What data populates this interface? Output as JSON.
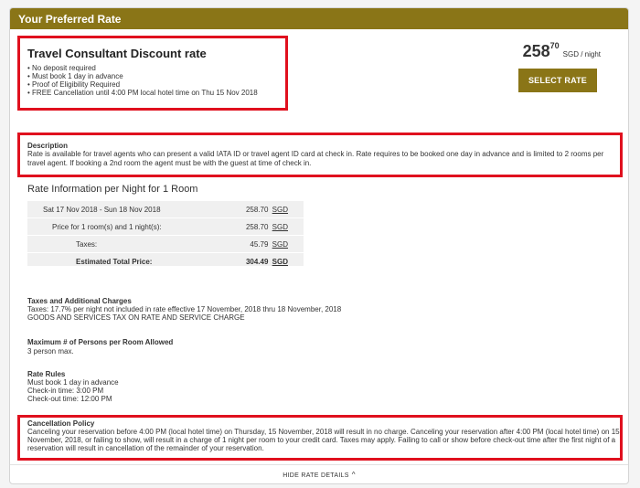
{
  "header": {
    "title": "Your Preferred Rate"
  },
  "rate": {
    "name": "Travel Consultant Discount rate",
    "bullets": [
      "No deposit required",
      "Must book 1 day in advance",
      "Proof of Eligibility Required",
      "FREE Cancellation until 4:00 PM local hotel time on Thu 15 Nov 2018"
    ],
    "price_whole": "258",
    "price_cents": "70",
    "price_unit": "SGD / night",
    "select_label": "SELECT RATE"
  },
  "description": {
    "heading": "Description",
    "text": "Rate is available for travel agents who can present a valid IATA ID or travel agent ID card at check in. Rate requires to be booked one day in advance and is limited to 2 rooms per travel agent. If booking a 2nd room the agent must be with the guest at time of check in."
  },
  "rate_info": {
    "title": "Rate Information per Night for 1 Room",
    "rows": [
      {
        "label": "Sat 17 Nov 2018 - Sun 18 Nov 2018",
        "amount": "258.70",
        "currency": "SGD"
      },
      {
        "label": "Price for 1 room(s) and 1 night(s):",
        "amount": "258.70",
        "currency": "SGD"
      },
      {
        "label": "Taxes:",
        "amount": "45.79",
        "currency": "SGD"
      },
      {
        "label": "Estimated Total Price:",
        "amount": "304.49",
        "currency": "SGD"
      }
    ]
  },
  "taxes": {
    "heading": "Taxes and Additional Charges",
    "line1": "Taxes:  17.7% per night not included in rate effective 17 November, 2018 thru 18 November, 2018",
    "line2": "GOODS AND SERVICES TAX ON RATE AND SERVICE CHARGE"
  },
  "persons": {
    "heading": "Maximum # of Persons per Room Allowed",
    "text": "3 person max."
  },
  "rules": {
    "heading": "Rate Rules",
    "lines": [
      "Must book 1 day in advance",
      "Check-in time: 3:00 PM",
      "Check-out time: 12:00 PM"
    ]
  },
  "cancellation": {
    "heading": "Cancellation Policy",
    "text": "Canceling your reservation before 4:00 PM (local hotel time) on Thursday, 15 November, 2018 will result in no charge. Canceling your reservation after 4:00 PM (local hotel time) on 15 November, 2018, or failing to show, will result in a charge of 1 night per room to your credit card. Taxes may apply. Failing to call or show before check-out time after the first night of a reservation will result in cancellation of the remainder of your reservation."
  },
  "footer": {
    "hide_label": "HIDE RATE DETAILS",
    "chevron": "^"
  },
  "colors": {
    "accent": "#8a7517",
    "highlight": "#e0101e"
  }
}
